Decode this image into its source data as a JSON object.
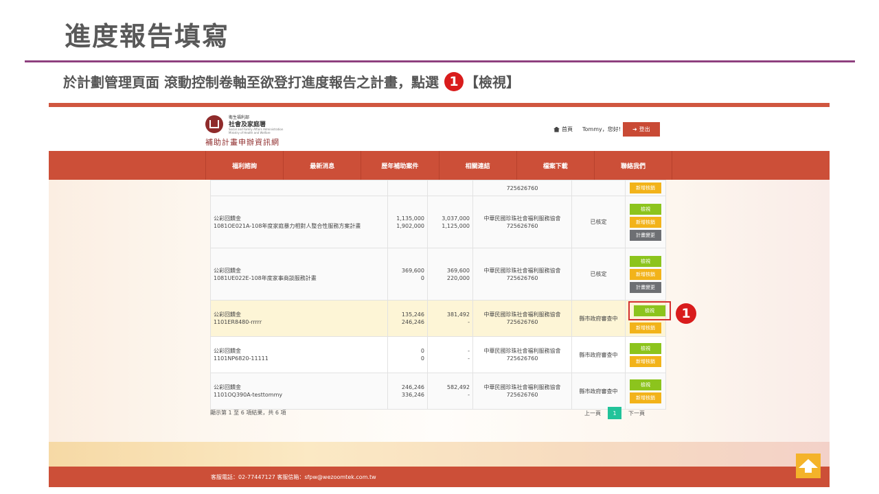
{
  "slide": {
    "title": "進度報告填寫",
    "subtitle_pre": "於計劃管理頁面 滾動控制卷軸至欲登打進度報告之計畫，點選",
    "step": "1",
    "subtitle_post": "【檢視】"
  },
  "header": {
    "logo_org_line1": "衛生福利部",
    "logo_org_line2": "社會及家庭署",
    "logo_org_en": "Social and Family Affairs Administration Ministry of Health and Welfare",
    "logo_site": "補助計畫申辦資訊網",
    "home": "首頁",
    "user": "Tommy，您好!",
    "logout": "登出"
  },
  "nav": [
    "福利諮詢",
    "最新消息",
    "歷年補助案件",
    "相關連結",
    "檔案下載",
    "聯絡我們"
  ],
  "rows": [
    {
      "type": "cut",
      "name_l1": "",
      "name_l2": "",
      "num_a1": "",
      "num_a2": "",
      "num_b1": "",
      "num_b2": "",
      "org": "725626760",
      "status": "",
      "actions": [
        "新增核銷"
      ]
    },
    {
      "type": "odd",
      "name_l1": "公彩回饋金",
      "name_l2": "1081OE021A-108年度家庭暴力相對人整合性服務方案計畫",
      "num_a1": "1,135,000",
      "num_a2": "1,902,000",
      "num_b1": "3,037,000",
      "num_b2": "1,125,000",
      "org_l1": "中華民國珍珠社會福利服務協會",
      "org": "725626760",
      "status": "已核定",
      "actions": [
        "檢視",
        "新增核銷",
        "計畫變更"
      ]
    },
    {
      "type": "odd",
      "name_l1": "公彩回饋金",
      "name_l2": "1081UE022E-108年度家事商談服務計畫",
      "num_a1": "369,600",
      "num_a2": "0",
      "num_b1": "369,600",
      "num_b2": "220,000",
      "org_l1": "中華民國珍珠社會福利服務協會",
      "org": "725626760",
      "status": "已核定",
      "actions": [
        "檢視",
        "新增核銷",
        "計畫變更"
      ]
    },
    {
      "type": "hl",
      "name_l1": "公彩回饋金",
      "name_l2": "1101ER8480-rrrrr",
      "num_a1": "135,246",
      "num_a2": "246,246",
      "num_b1": "381,492",
      "num_b2": "-",
      "org_l1": "中華民國珍珠社會福利服務協會",
      "org": "725626760",
      "status": "縣市政府審查中",
      "actions": [
        "檢視",
        "新增核銷"
      ]
    },
    {
      "type": "even",
      "name_l1": "公彩回饋金",
      "name_l2": "1101NP6820-11111",
      "num_a1": "0",
      "num_a2": "0",
      "num_b1": "-",
      "num_b2": "-",
      "org_l1": "中華民國珍珠社會福利服務協會",
      "org": "725626760",
      "status": "縣市政府審查中",
      "actions": [
        "檢視",
        "新增核銷"
      ]
    },
    {
      "type": "odd",
      "name_l1": "公彩回饋金",
      "name_l2": "1101OQ390A-testtommy",
      "num_a1": "246,246",
      "num_a2": "336,246",
      "num_b1": "582,492",
      "num_b2": "-",
      "org_l1": "中華民國珍珠社會福利服務協會",
      "org": "725626760",
      "status": "縣市政府審查中",
      "actions": [
        "檢視",
        "新增核銷"
      ]
    }
  ],
  "paging": {
    "info": "顯示第 1 至 6 項結果，共 6 項",
    "prev": "上一頁",
    "current": "1",
    "next": "下一頁"
  },
  "footer": {
    "text": "客服電話：02-77447127 客服信箱：sfpw@wezoomtek.com.tw"
  },
  "callout": "1",
  "colors": {
    "brand": "#cc4f38",
    "view": "#8cc41d",
    "add": "#f2b31a",
    "change": "#6d6f73",
    "highlight": "#fdf5d6",
    "callout": "#d91c1c",
    "rule": "#8e3f7e"
  }
}
